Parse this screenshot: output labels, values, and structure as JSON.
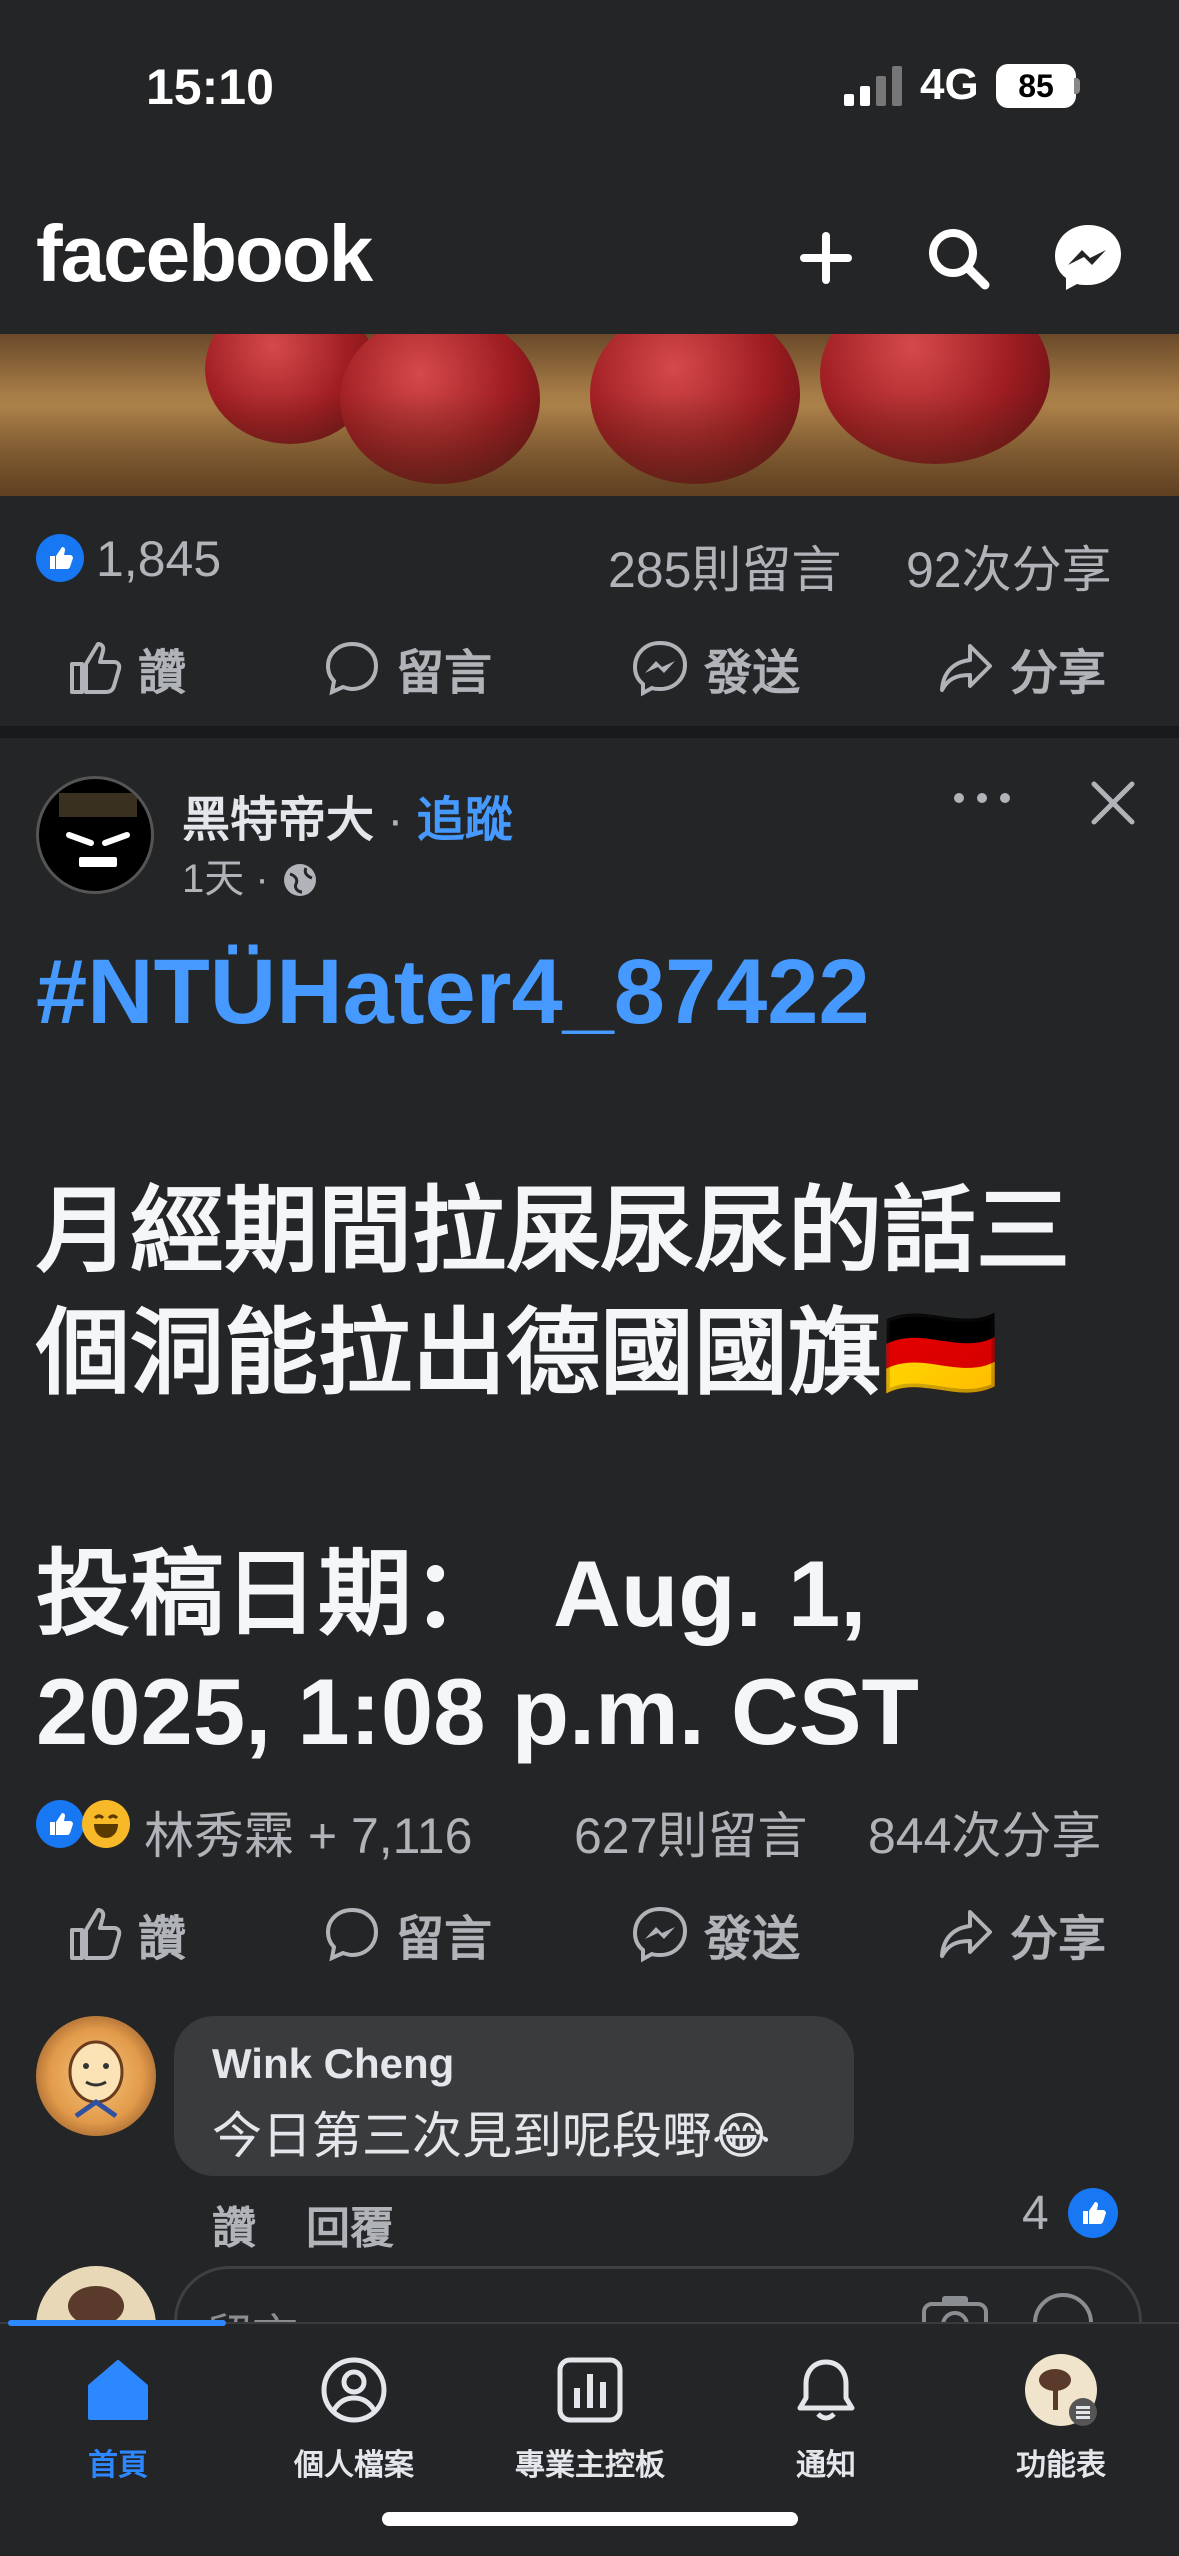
{
  "status_bar": {
    "time": "15:10",
    "network": "4G",
    "battery": "85"
  },
  "header": {
    "logo": "facebook"
  },
  "post1": {
    "reactions_count": "1,845",
    "comments": "285則留言",
    "shares": "92次分享"
  },
  "actions": {
    "like": "讚",
    "comment": "留言",
    "send": "發送",
    "share": "分享"
  },
  "post2": {
    "page_name": "黑特帝大",
    "separator": "·",
    "follow": "追蹤",
    "time": "1天",
    "meta_dot": "·",
    "hashtag": "#NTÜHater4_87422",
    "body_line1": "月經期間拉屎尿尿的話三",
    "body_line2": "個洞能拉出德國國旗🇩🇪",
    "date_line1": "投稿日期：　Aug. 1,",
    "date_line2": "2025, 1:08 p.m. CST",
    "reactions_text": "林秀霖 + 7,116",
    "comments": "627則留言",
    "shares": "844次分享"
  },
  "comment": {
    "author": "Wink Cheng",
    "text": "今日第三次見到呢段嘢😂",
    "like": "讚",
    "reply": "回覆",
    "like_count": "4"
  },
  "reply_box": {
    "placeholder": "留言"
  },
  "bottom_nav": [
    {
      "label": "首頁",
      "icon": "home-icon",
      "active": true
    },
    {
      "label": "個人檔案",
      "icon": "profile-icon"
    },
    {
      "label": "專業主控板",
      "icon": "dashboard-icon"
    },
    {
      "label": "通知",
      "icon": "bell-icon"
    },
    {
      "label": "功能表",
      "icon": "menu-avatar-icon"
    }
  ],
  "colors": {
    "background": "#242526",
    "accent": "#4599ff",
    "like_blue": "#1877f2"
  }
}
